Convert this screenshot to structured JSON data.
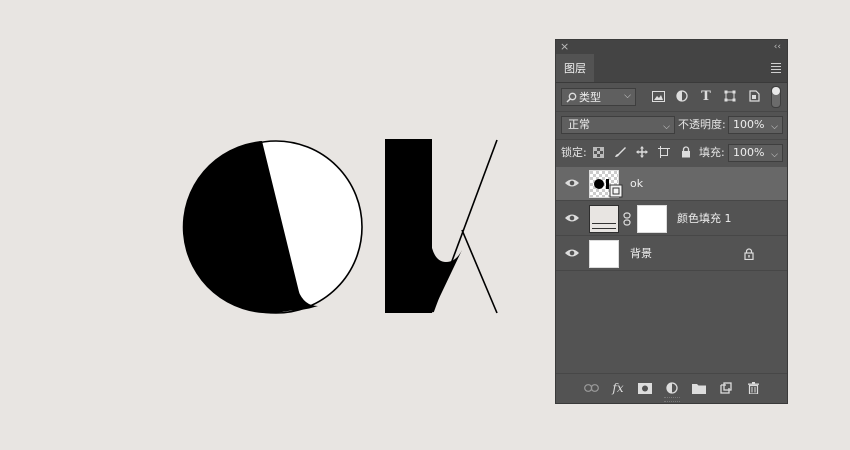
{
  "panel": {
    "tab_title": "图层",
    "close_glyph": "×",
    "collapse_glyph": "‹‹"
  },
  "filter": {
    "kind_label": "类型",
    "icons": [
      "image-filter-icon",
      "adjustment-filter-icon",
      "type-filter-icon",
      "shape-filter-icon",
      "smart-object-filter-icon"
    ]
  },
  "blend": {
    "mode": "正常",
    "opacity_label": "不透明度:",
    "opacity_value": "100%"
  },
  "lock": {
    "label": "锁定:",
    "fill_label": "填充:",
    "fill_value": "100%"
  },
  "layers": [
    {
      "name": "ok",
      "selected": true,
      "type": "smart-object"
    },
    {
      "name": "颜色填充 1",
      "selected": false,
      "type": "fill"
    },
    {
      "name": "背景",
      "selected": false,
      "type": "background",
      "locked": true
    }
  ],
  "bottom": {
    "fx_label": "fx",
    "icons": [
      "link-layers-icon",
      "fx-icon",
      "mask-icon",
      "adjustment-icon",
      "group-folder-icon",
      "new-layer-icon",
      "trash-icon"
    ]
  },
  "colors": {
    "canvas_bg": "#e8e5e2",
    "panel_bg": "#535353",
    "selected_row": "#686868",
    "art": "#000000"
  }
}
